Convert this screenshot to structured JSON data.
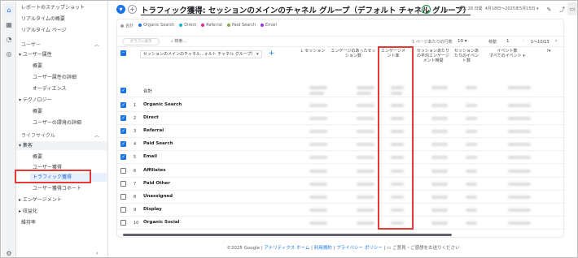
{
  "sidebar": {
    "top_items": [
      "レポートのスナップショット",
      "リアルタイムの概要",
      "リアルタイム ページ"
    ],
    "sections": [
      {
        "label": "ユーザー"
      },
      {
        "label": "ライフサイクル"
      }
    ],
    "groups": {
      "user_attr": "ユーザー属性",
      "user_attr_children": [
        "概要",
        "ユーザー属性の詳細",
        "オーディエンス"
      ],
      "tech": "テクノロジー",
      "tech_children": [
        "概要",
        "ユーザーの環境の詳細"
      ],
      "acq": "集客",
      "acq_children": [
        "概要",
        "ユーザー獲得",
        "トラフィック獲得",
        "ユーザー獲得コホート"
      ],
      "engagement": "エンゲージメント",
      "monetization": "収益化",
      "retention": "維持率"
    }
  },
  "topbar": {
    "title": "トラフィック獲得: セッションのメインのチャネル グループ（デフォルト チャネル グループ）",
    "date_prefix": "過去 28 日間",
    "date_range": "4月18日～2025年5月15日"
  },
  "legend": [
    "合計",
    "Organic Search",
    "Direct",
    "Referral",
    "Paid Search",
    "Email"
  ],
  "legend_colors": [
    "#9aa0a6",
    "#1a73e8",
    "#12b5cb",
    "#e52592",
    "#7cb342",
    "#9334e6"
  ],
  "toolbar": {
    "chip": "グラフに表示",
    "search_placeholder": "検索...",
    "rows_per_page_label": "1 ページあたりの行数",
    "rows_per_page": "10",
    "goto_label": "移動",
    "goto_value": "1",
    "pager": "1〜10/13"
  },
  "table": {
    "dimension_header": "セッションのメインのチャネル...ォルト チャネル グループ）",
    "col_headers": [
      "セッション",
      "エンゲージのあったセッション数",
      "エンゲージメント率",
      "セッションあたりの平均エンゲージメント時間",
      "セッションあたりのイベント数",
      "イベント数",
      "すべてのイベント"
    ],
    "total_label": "合計",
    "rows": [
      {
        "n": "1",
        "label": "Organic Search",
        "checked": true
      },
      {
        "n": "2",
        "label": "Direct",
        "checked": true
      },
      {
        "n": "3",
        "label": "Referral",
        "checked": true
      },
      {
        "n": "4",
        "label": "Paid Search",
        "checked": true
      },
      {
        "n": "5",
        "label": "Email",
        "checked": true
      },
      {
        "n": "6",
        "label": "Affiliates",
        "checked": false
      },
      {
        "n": "7",
        "label": "Paid Other",
        "checked": false
      },
      {
        "n": "8",
        "label": "Unassigned",
        "checked": false
      },
      {
        "n": "9",
        "label": "Display",
        "checked": false
      },
      {
        "n": "10",
        "label": "Organic Social",
        "checked": false
      }
    ]
  },
  "footer": {
    "copyright": "©2025 Google",
    "link1": "アナリティクス ホーム",
    "link2": "利用規約",
    "link3": "プライバシー ポリシー",
    "feedback": "ご意見・ご感想をお送りください"
  }
}
